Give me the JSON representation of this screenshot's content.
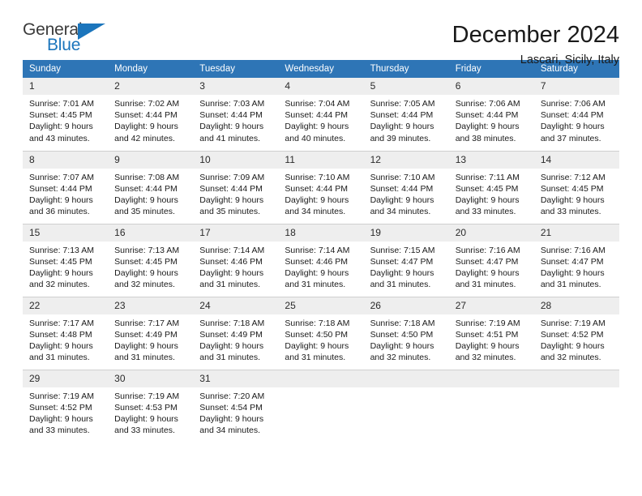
{
  "brand": {
    "name_top": "General",
    "name_bottom": "Blue",
    "color_dark": "#3b3b3b",
    "color_blue": "#1b75bc"
  },
  "header": {
    "title": "December 2024",
    "location": "Lascari, Sicily, Italy"
  },
  "theme": {
    "header_bg": "#2e75b6",
    "header_text": "#ffffff",
    "daynum_bg": "#eeeeee",
    "row_divider": "#cfcfcf"
  },
  "weekdays": [
    "Sunday",
    "Monday",
    "Tuesday",
    "Wednesday",
    "Thursday",
    "Friday",
    "Saturday"
  ],
  "weeks": [
    [
      {
        "day": "1",
        "sunrise": "Sunrise: 7:01 AM",
        "sunset": "Sunset: 4:45 PM",
        "daylight_1": "Daylight: 9 hours",
        "daylight_2": "and 43 minutes."
      },
      {
        "day": "2",
        "sunrise": "Sunrise: 7:02 AM",
        "sunset": "Sunset: 4:44 PM",
        "daylight_1": "Daylight: 9 hours",
        "daylight_2": "and 42 minutes."
      },
      {
        "day": "3",
        "sunrise": "Sunrise: 7:03 AM",
        "sunset": "Sunset: 4:44 PM",
        "daylight_1": "Daylight: 9 hours",
        "daylight_2": "and 41 minutes."
      },
      {
        "day": "4",
        "sunrise": "Sunrise: 7:04 AM",
        "sunset": "Sunset: 4:44 PM",
        "daylight_1": "Daylight: 9 hours",
        "daylight_2": "and 40 minutes."
      },
      {
        "day": "5",
        "sunrise": "Sunrise: 7:05 AM",
        "sunset": "Sunset: 4:44 PM",
        "daylight_1": "Daylight: 9 hours",
        "daylight_2": "and 39 minutes."
      },
      {
        "day": "6",
        "sunrise": "Sunrise: 7:06 AM",
        "sunset": "Sunset: 4:44 PM",
        "daylight_1": "Daylight: 9 hours",
        "daylight_2": "and 38 minutes."
      },
      {
        "day": "7",
        "sunrise": "Sunrise: 7:06 AM",
        "sunset": "Sunset: 4:44 PM",
        "daylight_1": "Daylight: 9 hours",
        "daylight_2": "and 37 minutes."
      }
    ],
    [
      {
        "day": "8",
        "sunrise": "Sunrise: 7:07 AM",
        "sunset": "Sunset: 4:44 PM",
        "daylight_1": "Daylight: 9 hours",
        "daylight_2": "and 36 minutes."
      },
      {
        "day": "9",
        "sunrise": "Sunrise: 7:08 AM",
        "sunset": "Sunset: 4:44 PM",
        "daylight_1": "Daylight: 9 hours",
        "daylight_2": "and 35 minutes."
      },
      {
        "day": "10",
        "sunrise": "Sunrise: 7:09 AM",
        "sunset": "Sunset: 4:44 PM",
        "daylight_1": "Daylight: 9 hours",
        "daylight_2": "and 35 minutes."
      },
      {
        "day": "11",
        "sunrise": "Sunrise: 7:10 AM",
        "sunset": "Sunset: 4:44 PM",
        "daylight_1": "Daylight: 9 hours",
        "daylight_2": "and 34 minutes."
      },
      {
        "day": "12",
        "sunrise": "Sunrise: 7:10 AM",
        "sunset": "Sunset: 4:44 PM",
        "daylight_1": "Daylight: 9 hours",
        "daylight_2": "and 34 minutes."
      },
      {
        "day": "13",
        "sunrise": "Sunrise: 7:11 AM",
        "sunset": "Sunset: 4:45 PM",
        "daylight_1": "Daylight: 9 hours",
        "daylight_2": "and 33 minutes."
      },
      {
        "day": "14",
        "sunrise": "Sunrise: 7:12 AM",
        "sunset": "Sunset: 4:45 PM",
        "daylight_1": "Daylight: 9 hours",
        "daylight_2": "and 33 minutes."
      }
    ],
    [
      {
        "day": "15",
        "sunrise": "Sunrise: 7:13 AM",
        "sunset": "Sunset: 4:45 PM",
        "daylight_1": "Daylight: 9 hours",
        "daylight_2": "and 32 minutes."
      },
      {
        "day": "16",
        "sunrise": "Sunrise: 7:13 AM",
        "sunset": "Sunset: 4:45 PM",
        "daylight_1": "Daylight: 9 hours",
        "daylight_2": "and 32 minutes."
      },
      {
        "day": "17",
        "sunrise": "Sunrise: 7:14 AM",
        "sunset": "Sunset: 4:46 PM",
        "daylight_1": "Daylight: 9 hours",
        "daylight_2": "and 31 minutes."
      },
      {
        "day": "18",
        "sunrise": "Sunrise: 7:14 AM",
        "sunset": "Sunset: 4:46 PM",
        "daylight_1": "Daylight: 9 hours",
        "daylight_2": "and 31 minutes."
      },
      {
        "day": "19",
        "sunrise": "Sunrise: 7:15 AM",
        "sunset": "Sunset: 4:47 PM",
        "daylight_1": "Daylight: 9 hours",
        "daylight_2": "and 31 minutes."
      },
      {
        "day": "20",
        "sunrise": "Sunrise: 7:16 AM",
        "sunset": "Sunset: 4:47 PM",
        "daylight_1": "Daylight: 9 hours",
        "daylight_2": "and 31 minutes."
      },
      {
        "day": "21",
        "sunrise": "Sunrise: 7:16 AM",
        "sunset": "Sunset: 4:47 PM",
        "daylight_1": "Daylight: 9 hours",
        "daylight_2": "and 31 minutes."
      }
    ],
    [
      {
        "day": "22",
        "sunrise": "Sunrise: 7:17 AM",
        "sunset": "Sunset: 4:48 PM",
        "daylight_1": "Daylight: 9 hours",
        "daylight_2": "and 31 minutes."
      },
      {
        "day": "23",
        "sunrise": "Sunrise: 7:17 AM",
        "sunset": "Sunset: 4:49 PM",
        "daylight_1": "Daylight: 9 hours",
        "daylight_2": "and 31 minutes."
      },
      {
        "day": "24",
        "sunrise": "Sunrise: 7:18 AM",
        "sunset": "Sunset: 4:49 PM",
        "daylight_1": "Daylight: 9 hours",
        "daylight_2": "and 31 minutes."
      },
      {
        "day": "25",
        "sunrise": "Sunrise: 7:18 AM",
        "sunset": "Sunset: 4:50 PM",
        "daylight_1": "Daylight: 9 hours",
        "daylight_2": "and 31 minutes."
      },
      {
        "day": "26",
        "sunrise": "Sunrise: 7:18 AM",
        "sunset": "Sunset: 4:50 PM",
        "daylight_1": "Daylight: 9 hours",
        "daylight_2": "and 32 minutes."
      },
      {
        "day": "27",
        "sunrise": "Sunrise: 7:19 AM",
        "sunset": "Sunset: 4:51 PM",
        "daylight_1": "Daylight: 9 hours",
        "daylight_2": "and 32 minutes."
      },
      {
        "day": "28",
        "sunrise": "Sunrise: 7:19 AM",
        "sunset": "Sunset: 4:52 PM",
        "daylight_1": "Daylight: 9 hours",
        "daylight_2": "and 32 minutes."
      }
    ],
    [
      {
        "day": "29",
        "sunrise": "Sunrise: 7:19 AM",
        "sunset": "Sunset: 4:52 PM",
        "daylight_1": "Daylight: 9 hours",
        "daylight_2": "and 33 minutes."
      },
      {
        "day": "30",
        "sunrise": "Sunrise: 7:19 AM",
        "sunset": "Sunset: 4:53 PM",
        "daylight_1": "Daylight: 9 hours",
        "daylight_2": "and 33 minutes."
      },
      {
        "day": "31",
        "sunrise": "Sunrise: 7:20 AM",
        "sunset": "Sunset: 4:54 PM",
        "daylight_1": "Daylight: 9 hours",
        "daylight_2": "and 34 minutes."
      },
      {
        "day": "",
        "sunrise": "",
        "sunset": "",
        "daylight_1": "",
        "daylight_2": ""
      },
      {
        "day": "",
        "sunrise": "",
        "sunset": "",
        "daylight_1": "",
        "daylight_2": ""
      },
      {
        "day": "",
        "sunrise": "",
        "sunset": "",
        "daylight_1": "",
        "daylight_2": ""
      },
      {
        "day": "",
        "sunrise": "",
        "sunset": "",
        "daylight_1": "",
        "daylight_2": ""
      }
    ]
  ]
}
